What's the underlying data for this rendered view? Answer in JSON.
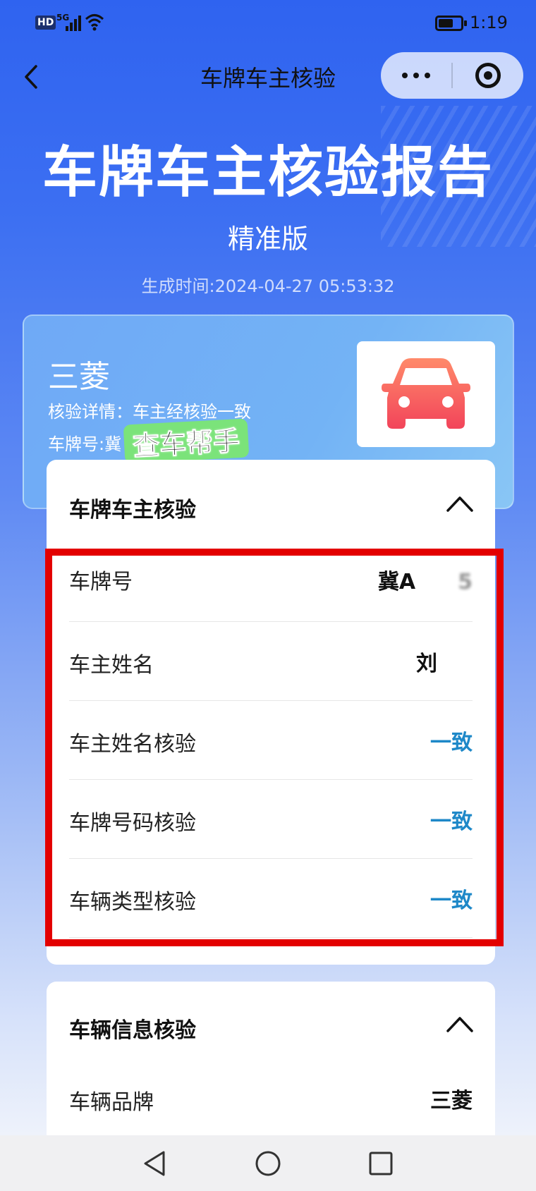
{
  "status_bar": {
    "hd": "HD",
    "network": "5G",
    "time": "1:19"
  },
  "nav": {
    "title": "车牌车主核验"
  },
  "report": {
    "title": "车牌车主核验报告",
    "edition": "精准版",
    "generated_time": "生成时间:2024-04-27 05:53:32"
  },
  "summary": {
    "brand": "三菱",
    "verify_detail": "核验详情：车主经核验一致",
    "plate_label": "车牌号:冀",
    "car_icon_color": "#ff6a5a"
  },
  "watermark": "查车帮手",
  "section_owner": {
    "title": "车牌车主核验",
    "rows": [
      {
        "label": "车牌号",
        "value_visible": "冀A",
        "value_blurred": "5"
      },
      {
        "label": "车主姓名",
        "value_visible": "刘",
        "value_blurred": ""
      },
      {
        "label": "车主姓名核验",
        "value": "一致"
      },
      {
        "label": "车牌号码核验",
        "value": "一致"
      },
      {
        "label": "车辆类型核验",
        "value": "一致"
      }
    ]
  },
  "section_vehicle": {
    "title": "车辆信息核验",
    "rows": [
      {
        "label": "车辆品牌",
        "value": "三菱"
      }
    ]
  },
  "colors": {
    "accent_ok": "#1e88c8",
    "highlight": "#e30000",
    "header_blue": "#2f63f0"
  }
}
